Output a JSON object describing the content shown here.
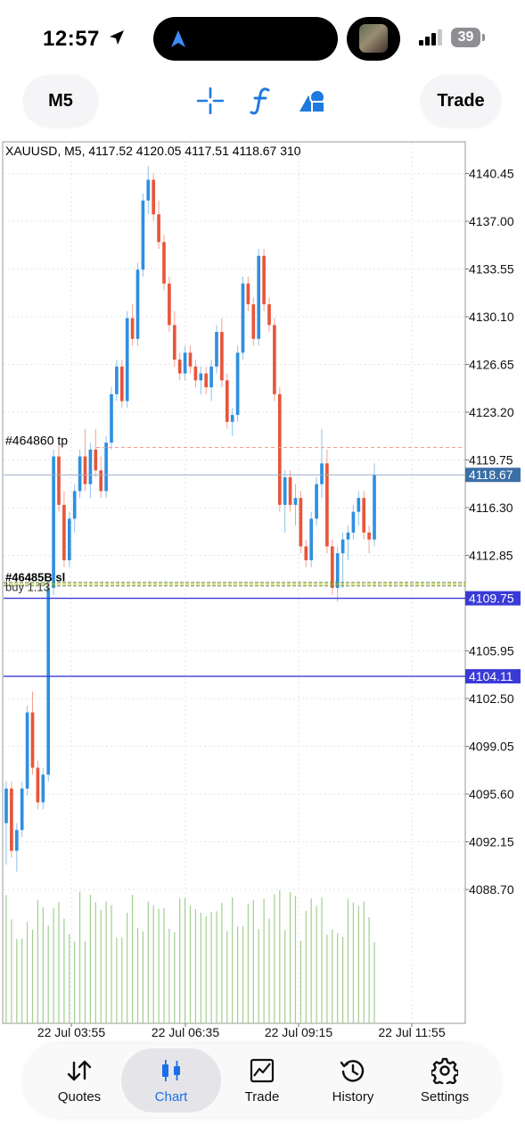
{
  "status_bar": {
    "time": "12:57",
    "battery": "39"
  },
  "toolbar": {
    "timeframe": "M5",
    "trade": "Trade"
  },
  "chart": {
    "header": "XAUUSD, M5, 4117.52 4120.05 4117.51 4118.67 310",
    "order_label_tp": "#464860 tp",
    "order_label_group": "#46485B sl",
    "order_label_buy": "buy 1.13",
    "price_labels": [
      "4140.45",
      "4137.00",
      "4133.55",
      "4130.10",
      "4126.65",
      "4123.20",
      "4119.75",
      "4116.30",
      "4112.85",
      "4105.95",
      "4102.50",
      "4099.05",
      "4095.60",
      "4092.15",
      "4088.70"
    ],
    "current_price": "4118.67",
    "level_1": "4109.75",
    "level_2": "4104.11",
    "time_labels": [
      "22 Jul 03:55",
      "22 Jul 06:35",
      "22 Jul 09:15",
      "22 Jul 11:55"
    ],
    "colors": {
      "up": "#2f8fe0",
      "down": "#e8553a",
      "volume": "#9fd08e",
      "level": "#3a3ad6",
      "current": "#3a6ea5",
      "grid": "#e6e6e6"
    }
  },
  "chart_data": {
    "type": "candlestick",
    "symbol": "XAUUSD",
    "timeframe": "M5",
    "ohlc_current": {
      "open": 4117.52,
      "high": 4120.05,
      "low": 4117.51,
      "close": 4118.67,
      "volume": 310
    },
    "ylim": [
      4086.5,
      4142.5
    ],
    "x_ticks": [
      "22 Jul 03:55",
      "22 Jul 06:35",
      "22 Jul 09:15",
      "22 Jul 11:55"
    ],
    "candles": [
      [
        4093.5,
        4096.5,
        4090.5,
        4096.0
      ],
      [
        4096.0,
        4096.5,
        4091.0,
        4091.5
      ],
      [
        4091.5,
        4093.5,
        4090.0,
        4093.0
      ],
      [
        4093.0,
        4096.5,
        4092.5,
        4096.0
      ],
      [
        4096.0,
        4102.0,
        4095.5,
        4101.5
      ],
      [
        4101.5,
        4103.0,
        4097.0,
        4097.5
      ],
      [
        4097.5,
        4098.0,
        4094.5,
        4095.0
      ],
      [
        4095.0,
        4097.5,
        4094.5,
        4097.0
      ],
      [
        4097.0,
        4111.0,
        4096.5,
        4110.5
      ],
      [
        4110.5,
        4120.5,
        4110.0,
        4120.0
      ],
      [
        4120.0,
        4121.0,
        4116.0,
        4116.5
      ],
      [
        4116.5,
        4117.5,
        4112.0,
        4112.5
      ],
      [
        4112.5,
        4116.0,
        4112.0,
        4115.5
      ],
      [
        4115.5,
        4118.0,
        4114.5,
        4117.5
      ],
      [
        4117.5,
        4120.5,
        4117.0,
        4120.0
      ],
      [
        4120.0,
        4122.0,
        4117.5,
        4118.0
      ],
      [
        4118.0,
        4121.0,
        4117.0,
        4120.5
      ],
      [
        4120.5,
        4122.0,
        4118.5,
        4119.0
      ],
      [
        4119.0,
        4120.0,
        4117.0,
        4117.5
      ],
      [
        4117.5,
        4121.5,
        4117.0,
        4121.0
      ],
      [
        4121.0,
        4125.0,
        4120.5,
        4124.5
      ],
      [
        4124.5,
        4127.0,
        4124.0,
        4126.5
      ],
      [
        4126.5,
        4127.0,
        4123.5,
        4124.0
      ],
      [
        4124.0,
        4130.5,
        4123.5,
        4130.0
      ],
      [
        4130.0,
        4131.0,
        4128.0,
        4128.5
      ],
      [
        4128.5,
        4134.0,
        4128.0,
        4133.5
      ],
      [
        4133.5,
        4139.0,
        4133.0,
        4138.5
      ],
      [
        4138.5,
        4141.0,
        4137.5,
        4140.0
      ],
      [
        4140.0,
        4140.5,
        4137.0,
        4137.5
      ],
      [
        4137.5,
        4138.5,
        4135.0,
        4135.5
      ],
      [
        4135.5,
        4136.0,
        4132.0,
        4132.5
      ],
      [
        4132.5,
        4133.0,
        4129.0,
        4129.5
      ],
      [
        4129.5,
        4130.5,
        4126.5,
        4127.0
      ],
      [
        4127.0,
        4127.5,
        4125.5,
        4126.0
      ],
      [
        4126.0,
        4128.0,
        4125.5,
        4127.5
      ],
      [
        4127.5,
        4128.0,
        4126.0,
        4126.5
      ],
      [
        4126.5,
        4127.0,
        4125.0,
        4125.5
      ],
      [
        4125.5,
        4126.5,
        4124.5,
        4126.0
      ],
      [
        4126.0,
        4126.5,
        4124.5,
        4125.0
      ],
      [
        4125.0,
        4127.0,
        4124.0,
        4126.5
      ],
      [
        4126.5,
        4129.5,
        4126.0,
        4129.0
      ],
      [
        4129.0,
        4130.0,
        4125.0,
        4125.5
      ],
      [
        4125.5,
        4126.0,
        4122.0,
        4122.5
      ],
      [
        4122.5,
        4123.5,
        4121.5,
        4123.0
      ],
      [
        4123.0,
        4128.0,
        4122.5,
        4127.5
      ],
      [
        4127.5,
        4133.0,
        4127.0,
        4132.5
      ],
      [
        4132.5,
        4133.0,
        4130.5,
        4131.0
      ],
      [
        4131.0,
        4131.5,
        4128.0,
        4128.5
      ],
      [
        4128.5,
        4135.0,
        4128.0,
        4134.5
      ],
      [
        4134.5,
        4135.0,
        4130.5,
        4131.0
      ],
      [
        4131.0,
        4131.5,
        4129.0,
        4129.5
      ],
      [
        4129.5,
        4130.0,
        4124.0,
        4124.5
      ],
      [
        4124.5,
        4125.0,
        4116.0,
        4116.5
      ],
      [
        4116.5,
        4119.0,
        4114.5,
        4118.5
      ],
      [
        4118.5,
        4119.0,
        4116.0,
        4116.5
      ],
      [
        4116.5,
        4118.0,
        4115.0,
        4117.0
      ],
      [
        4117.0,
        4117.5,
        4113.0,
        4113.5
      ],
      [
        4113.5,
        4114.0,
        4112.0,
        4112.5
      ],
      [
        4112.5,
        4116.0,
        4112.0,
        4115.5
      ],
      [
        4115.5,
        4118.5,
        4115.0,
        4118.0
      ],
      [
        4118.0,
        4122.0,
        4117.0,
        4119.5
      ],
      [
        4119.5,
        4120.5,
        4113.0,
        4113.5
      ],
      [
        4113.5,
        4114.0,
        4110.0,
        4110.5
      ],
      [
        4110.5,
        4113.5,
        4109.5,
        4113.0
      ],
      [
        4113.0,
        4114.5,
        4110.5,
        4114.0
      ],
      [
        4114.0,
        4115.0,
        4112.5,
        4114.5
      ],
      [
        4114.5,
        4116.5,
        4114.0,
        4116.0
      ],
      [
        4116.0,
        4117.5,
        4115.0,
        4117.0
      ],
      [
        4117.0,
        4117.5,
        4114.0,
        4114.5
      ],
      [
        4114.5,
        4115.0,
        4113.0,
        4114.0
      ],
      [
        4114.0,
        4119.5,
        4113.5,
        4118.67
      ]
    ]
  },
  "nav": [
    {
      "label": "Quotes"
    },
    {
      "label": "Chart"
    },
    {
      "label": "Trade"
    },
    {
      "label": "History"
    },
    {
      "label": "Settings"
    }
  ]
}
